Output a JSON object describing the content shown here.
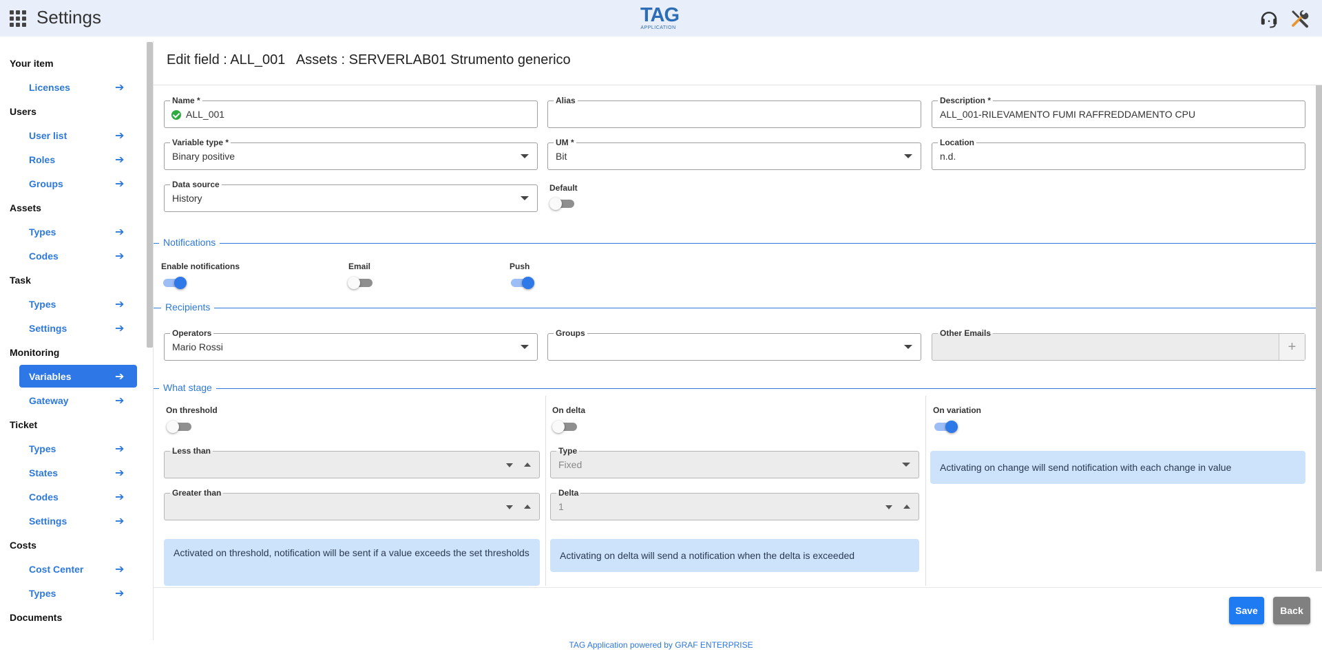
{
  "header": {
    "title": "Settings",
    "logo_main": "TAG",
    "logo_sub": "APPLICATION",
    "icons": [
      "apps-icon",
      "headset-icon",
      "tools-icon"
    ]
  },
  "sidebar": {
    "sections": [
      {
        "title": "Your item",
        "items": [
          "Licenses"
        ]
      },
      {
        "title": "Users",
        "items": [
          "User list",
          "Roles",
          "Groups"
        ]
      },
      {
        "title": "Assets",
        "items": [
          "Types",
          "Codes"
        ]
      },
      {
        "title": "Task",
        "items": [
          "Types",
          "Settings"
        ]
      },
      {
        "title": "Monitoring",
        "items": [
          "Variables",
          "Gateway"
        ]
      },
      {
        "title": "Ticket",
        "items": [
          "Types",
          "States",
          "Codes",
          "Settings"
        ]
      },
      {
        "title": "Costs",
        "items": [
          "Cost Center",
          "Types"
        ]
      },
      {
        "title": "Documents",
        "items": []
      }
    ],
    "active_item": "Variables",
    "accent_color": "#2d78db"
  },
  "page": {
    "title": "Edit field : ALL_001   Assets : SERVERLAB01 Strumento generico"
  },
  "form": {
    "name": {
      "label": "Name *",
      "value": "ALL_001"
    },
    "alias": {
      "label": "Alias",
      "value": ""
    },
    "description": {
      "label": "Description *",
      "value": "ALL_001-RILEVAMENTO FUMI RAFFREDDAMENTO CPU"
    },
    "variable_type": {
      "label": "Variable type *",
      "value": "Binary positive"
    },
    "um": {
      "label": "UM *",
      "value": "Bit"
    },
    "location": {
      "label": "Location",
      "value": "n.d."
    },
    "data_source": {
      "label": "Data source",
      "value": "History"
    },
    "default": {
      "label": "Default",
      "on": false
    }
  },
  "notifications": {
    "title": "Notifications",
    "enable": {
      "label": "Enable notifications",
      "on": true
    },
    "email": {
      "label": "Email",
      "on": false
    },
    "push": {
      "label": "Push",
      "on": true
    }
  },
  "recipients": {
    "title": "Recipients",
    "operators": {
      "label": "Operators",
      "value": "Mario Rossi"
    },
    "groups": {
      "label": "Groups",
      "value": ""
    },
    "other_emails": {
      "label": "Other Emails",
      "value": "",
      "add_label": "+"
    }
  },
  "what_stage": {
    "title": "What stage",
    "threshold": {
      "label": "On threshold",
      "on": false,
      "less_than": {
        "label": "Less than",
        "value": ""
      },
      "greater_than": {
        "label": "Greater than",
        "value": ""
      },
      "info": "Activated on threshold, notification will be sent if a value exceeds the set thresholds"
    },
    "delta": {
      "label": "On delta",
      "on": false,
      "type": {
        "label": "Type",
        "value": "Fixed"
      },
      "delta": {
        "label": "Delta",
        "value": "1"
      },
      "info": "Activating on delta will send a notification when the delta is exceeded"
    },
    "variation": {
      "label": "On variation",
      "on": true,
      "info": "Activating on change will send notification with each change in value"
    }
  },
  "actions": {
    "save": "Save",
    "back": "Back"
  },
  "footer": "TAG Application powered by GRAF ENTERPRISE"
}
